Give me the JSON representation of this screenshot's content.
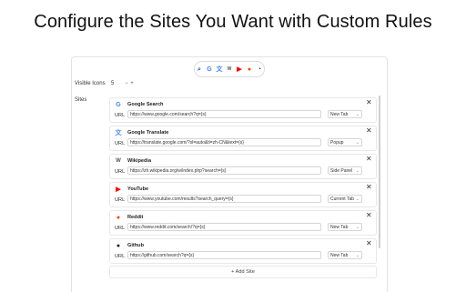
{
  "headline": "Configure the Sites You Want with Custom Rules",
  "visible_icons": {
    "label": "Visible Icons",
    "value": "5",
    "minus": "−",
    "plus": "+"
  },
  "sites_label": "Sites",
  "sites": [
    {
      "name": "Google Search",
      "icon_glyph": "G",
      "icon_color": "#4285F4",
      "url_label": "URL",
      "url": "https://www.google.com/search?q={s}",
      "mode": "New Tab",
      "chevron": "⌄"
    },
    {
      "name": "Google Translate",
      "icon_glyph": "文",
      "icon_color": "#4285F4",
      "url_label": "URL",
      "url": "https://translate.google.com/?sl=auto&tl=zh-CN&text={s}",
      "mode": "Popup",
      "chevron": "⌄"
    },
    {
      "name": "Wikipedia",
      "icon_glyph": "W",
      "icon_color": "#555555",
      "url_label": "URL",
      "url": "https://zh.wikipedia.org/w/index.php?search={s}",
      "mode": "Side Panel",
      "chevron": "⌄"
    },
    {
      "name": "YouTube",
      "icon_glyph": "▶",
      "icon_color": "#FF0000",
      "url_label": "URL",
      "url": "https://www.youtube.com/results?search_query={s}",
      "mode": "Current Tab",
      "chevron": "⌄"
    },
    {
      "name": "Reddit",
      "icon_glyph": "●",
      "icon_color": "#FF4500",
      "url_label": "URL",
      "url": "https://www.reddit.com/search/?q={s}",
      "mode": "New Tab",
      "chevron": "⌄"
    },
    {
      "name": "Github",
      "icon_glyph": "●",
      "icon_color": "#222222",
      "url_label": "URL",
      "url": "https://github.com/search?q={s}",
      "mode": "New Tab",
      "chevron": "⌄"
    }
  ],
  "close_glyph": "✕",
  "add_site": "+ Add Site",
  "icon_bar": [
    {
      "name": "search",
      "glyph": "⌕",
      "color": "#2b6cd6"
    },
    {
      "name": "google",
      "glyph": "G",
      "color": "#4285F4"
    },
    {
      "name": "translate",
      "glyph": "文",
      "color": "#4285F4"
    },
    {
      "name": "wikipedia",
      "glyph": "W",
      "color": "#555555"
    },
    {
      "name": "youtube",
      "glyph": "▶",
      "color": "#FF0000"
    },
    {
      "name": "reddit",
      "glyph": "●",
      "color": "#FF4500"
    },
    {
      "name": "loading",
      "glyph": "◔",
      "color": "#333333"
    }
  ]
}
